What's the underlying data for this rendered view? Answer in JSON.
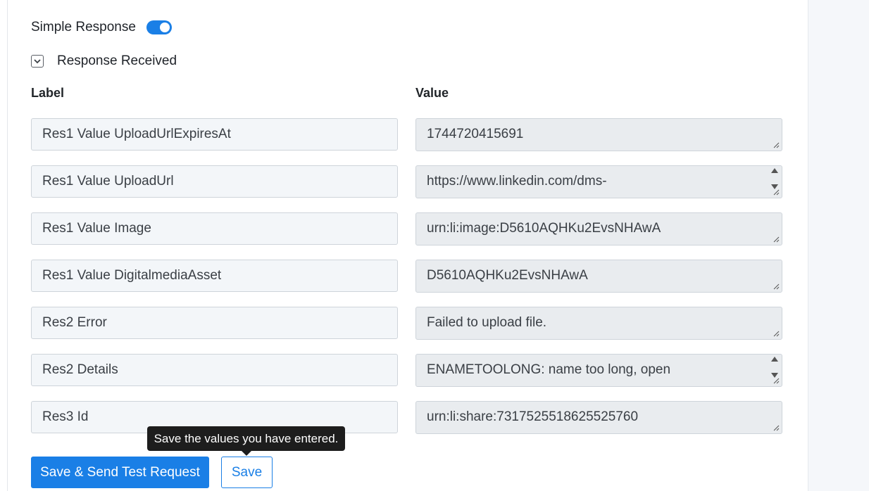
{
  "settings": {
    "simple_response_label": "Simple Response",
    "simple_response_on": true,
    "response_received_label": "Response Received"
  },
  "table": {
    "label_header": "Label",
    "value_header": "Value",
    "rows": [
      {
        "label": "Res1 Value UploadUrlExpiresAt",
        "value": "1744720415691"
      },
      {
        "label": "Res1 Value UploadUrl",
        "value": "https://www.linkedin.com/dms-"
      },
      {
        "label": "Res1 Value Image",
        "value": "urn:li:image:D5610AQHKu2EvsNHAwA"
      },
      {
        "label": "Res1 Value DigitalmediaAsset",
        "value": "D5610AQHKu2EvsNHAwA"
      },
      {
        "label": "Res2 Error",
        "value": "Failed to upload file."
      },
      {
        "label": "Res2 Details",
        "value": "ENAMETOOLONG: name too long, open"
      },
      {
        "label": "Res3 Id",
        "value": "urn:li:share:7317525518625525760"
      }
    ]
  },
  "actions": {
    "save_send_label": "Save & Send Test Request",
    "save_label": "Save",
    "tooltip": "Save the values you have entered."
  },
  "colors": {
    "accent": "#1a7fe6",
    "label_field_bg": "#f3f6f9",
    "value_field_bg": "#e9ecef",
    "tooltip_bg": "#1d1d1d"
  }
}
